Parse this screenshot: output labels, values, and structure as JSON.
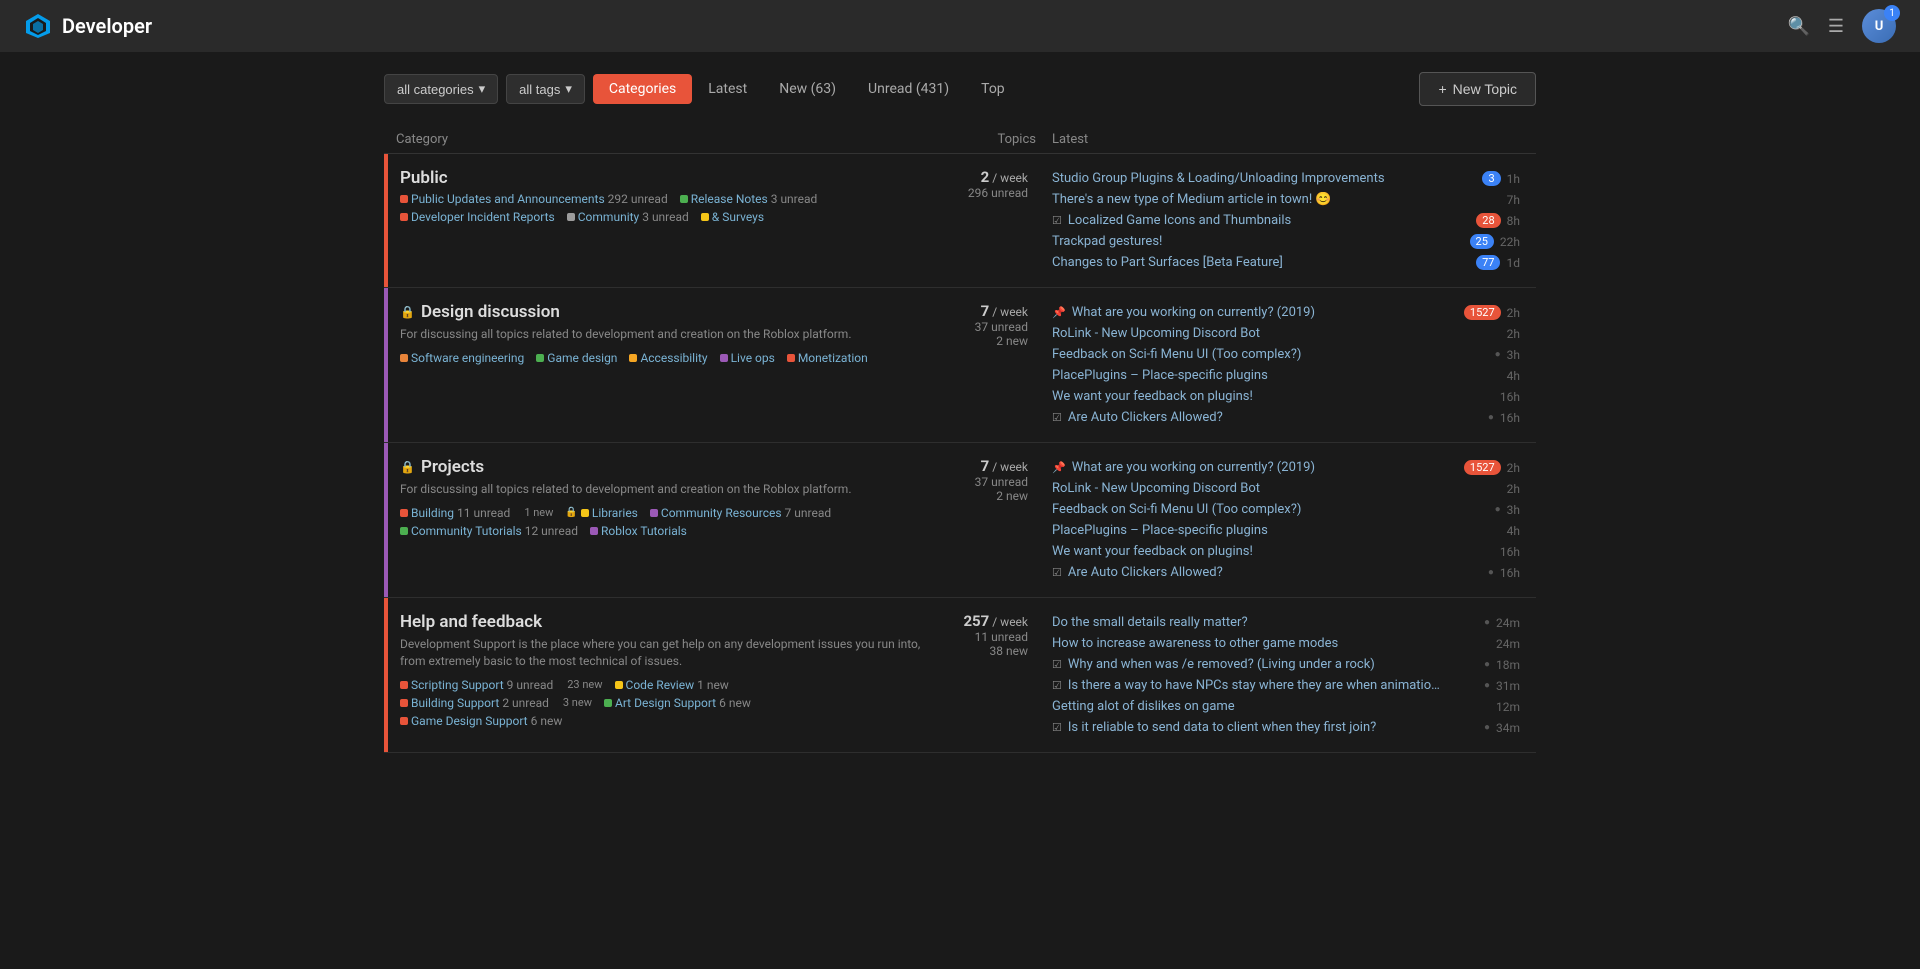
{
  "header": {
    "title": "Developer",
    "avatar_label": "U",
    "avatar_badge": "1"
  },
  "topbar": {
    "filter_category": "all categories",
    "filter_tags": "all tags",
    "tabs": [
      {
        "label": "Categories",
        "active": true
      },
      {
        "label": "Latest",
        "active": false
      },
      {
        "label": "New (63)",
        "active": false
      },
      {
        "label": "Unread (431)",
        "active": false
      },
      {
        "label": "Top",
        "active": false
      }
    ],
    "new_topic": "+ New Topic"
  },
  "columns": {
    "category": "Category",
    "topics": "Topics",
    "latest": "Latest"
  },
  "sections": [
    {
      "name": "Public",
      "lock": false,
      "color": "#e8543a",
      "desc": "",
      "subcats": [
        {
          "dot": "#e8543a",
          "name": "Public Updates and Announcements",
          "count": "292 unread",
          "lock": false
        },
        {
          "dot": "#4caf50",
          "name": "Release Notes",
          "count": "3 unread",
          "lock": false
        },
        {
          "dot": "#e8543a",
          "name": "Developer Incident Reports",
          "count": "",
          "lock": false
        },
        {
          "dot": "#9c9c9c",
          "name": "Community",
          "count": "3 unread",
          "lock": false
        },
        {
          "dot": "#f5c518",
          "name": "& Surveys",
          "count": "",
          "lock": false
        }
      ],
      "stats": {
        "count": "2",
        "per": "/ week",
        "unread": "296 unread"
      },
      "topics": [
        {
          "pin": false,
          "check": false,
          "text": "Studio Group Plugins & Loading/Unloading Improvements",
          "badge": "3",
          "badge_color": "blue",
          "time": "1h"
        },
        {
          "pin": false,
          "check": false,
          "text": "There's a new type of Medium article in town! 😊",
          "badge": null,
          "time": "7h"
        },
        {
          "pin": false,
          "check": true,
          "text": "Localized Game Icons and Thumbnails",
          "badge": "28",
          "badge_color": "orange",
          "time": "8h"
        },
        {
          "pin": false,
          "check": false,
          "text": "Trackpad gestures!",
          "badge": "25",
          "badge_color": "blue",
          "time": "22h"
        },
        {
          "pin": false,
          "check": false,
          "text": "Changes to Part Surfaces [Beta Feature]",
          "badge": "77",
          "badge_color": "blue",
          "time": "1d"
        }
      ]
    },
    {
      "name": "Design discussion",
      "lock": true,
      "color": "#9b59b6",
      "desc": "For discussing all topics related to development and creation on the Roblox platform.",
      "subcats": [
        {
          "dot": "#e8843a",
          "name": "Software engineering",
          "count": "",
          "lock": false
        },
        {
          "dot": "#4caf50",
          "name": "Game design",
          "count": "",
          "lock": false
        },
        {
          "dot": "#f5a623",
          "name": "Accessibility",
          "count": "",
          "lock": false
        },
        {
          "dot": "#9b59b6",
          "name": "Live ops",
          "count": "",
          "lock": false
        },
        {
          "dot": "#e8543a",
          "name": "Monetization",
          "count": "",
          "lock": false
        }
      ],
      "stats": {
        "count": "7",
        "per": "/ week",
        "unread": "37 unread",
        "new": "2 new"
      },
      "topics": [
        {
          "pin": true,
          "check": false,
          "text": "What are you working on currently? (2019)",
          "badge": "1527",
          "badge_color": "orange",
          "time": "2h"
        },
        {
          "pin": false,
          "check": false,
          "text": "RoLink - New Upcoming Discord Bot",
          "badge": null,
          "time": "2h"
        },
        {
          "pin": false,
          "check": false,
          "text": "Feedback on Sci-fi Menu UI (Too complex?)",
          "bullet": true,
          "badge": null,
          "time": "3h"
        },
        {
          "pin": false,
          "check": false,
          "text": "PlacePlugins – Place-specific plugins",
          "badge": null,
          "time": "4h"
        },
        {
          "pin": false,
          "check": false,
          "text": "We want your feedback on plugins!",
          "badge": null,
          "time": "16h"
        },
        {
          "pin": false,
          "check": true,
          "text": "Are Auto Clickers Allowed?",
          "bullet": true,
          "badge": null,
          "time": "16h"
        }
      ]
    },
    {
      "name": "Projects",
      "lock": true,
      "color": "#9b59b6",
      "desc": "For discussing all topics related to development and creation on the Roblox platform.",
      "subcats": [
        {
          "dot": "#e8543a",
          "name": "Building",
          "count": "11 unread",
          "new": "1 new",
          "lock": false
        },
        {
          "dot": "#f5c518",
          "name": "Libraries",
          "count": "",
          "lock": true
        },
        {
          "dot": "#9b59b6",
          "name": "Community Resources",
          "count": "7 unread",
          "lock": false
        },
        {
          "dot": "#4caf50",
          "name": "Community Tutorials",
          "count": "12 unread",
          "lock": false
        },
        {
          "dot": "#9b59b6",
          "name": "Roblox Tutorials",
          "count": "",
          "lock": false
        }
      ],
      "stats": {
        "count": "7",
        "per": "/ week",
        "unread": "37 unread",
        "new": "2 new"
      },
      "topics": [
        {
          "pin": true,
          "check": false,
          "text": "What are you working on currently? (2019)",
          "badge": "1527",
          "badge_color": "orange",
          "time": "2h"
        },
        {
          "pin": false,
          "check": false,
          "text": "RoLink - New Upcoming Discord Bot",
          "badge": null,
          "time": "2h"
        },
        {
          "pin": false,
          "check": false,
          "text": "Feedback on Sci-fi Menu UI (Too complex?)",
          "bullet": true,
          "badge": null,
          "time": "3h"
        },
        {
          "pin": false,
          "check": false,
          "text": "PlacePlugins – Place-specific plugins",
          "badge": null,
          "time": "4h"
        },
        {
          "pin": false,
          "check": false,
          "text": "We want your feedback on plugins!",
          "badge": null,
          "time": "16h"
        },
        {
          "pin": false,
          "check": true,
          "text": "Are Auto Clickers Allowed?",
          "bullet": true,
          "badge": null,
          "time": "16h"
        }
      ]
    },
    {
      "name": "Help and feedback",
      "lock": false,
      "color": "#e8543a",
      "desc": "Development Support is the place where you can get help on any development issues you run into, from extremely basic to the most technical of issues.",
      "subcats": [
        {
          "dot": "#e8543a",
          "name": "Scripting Support",
          "count": "9 unread",
          "new": "23 new",
          "lock": false
        },
        {
          "dot": "#f5c518",
          "name": "Code Review",
          "count": "1 new",
          "lock": false
        },
        {
          "dot": "#e8543a",
          "name": "Building Support",
          "count": "2 unread",
          "new": "3 new",
          "lock": false
        },
        {
          "dot": "#4caf50",
          "name": "Art Design Support",
          "count": "6 new",
          "lock": false
        },
        {
          "dot": "#e8543a",
          "name": "Game Design Support",
          "count": "6 new",
          "lock": false
        }
      ],
      "stats": {
        "count": "257",
        "per": "/ week",
        "unread": "11 unread",
        "new": "38 new"
      },
      "topics": [
        {
          "pin": false,
          "check": false,
          "text": "Do the small details really matter?",
          "bullet": true,
          "badge": null,
          "time": "24m"
        },
        {
          "pin": false,
          "check": false,
          "text": "How to increase awareness to other game modes",
          "badge": null,
          "time": "24m"
        },
        {
          "pin": false,
          "check": true,
          "text": "Why and when was /e removed? (Living under a rock)",
          "bullet": true,
          "badge": null,
          "time": "18m"
        },
        {
          "pin": false,
          "check": true,
          "text": "Is there a way to have NPCs stay where they are when animatio…",
          "bullet": true,
          "badge": null,
          "time": "31m"
        },
        {
          "pin": false,
          "check": false,
          "text": "Getting alot of dislikes on game",
          "badge": null,
          "time": "12m"
        },
        {
          "pin": false,
          "check": true,
          "text": "Is it reliable to send data to client when they first join?",
          "bullet": true,
          "badge": null,
          "time": "34m"
        }
      ]
    }
  ]
}
